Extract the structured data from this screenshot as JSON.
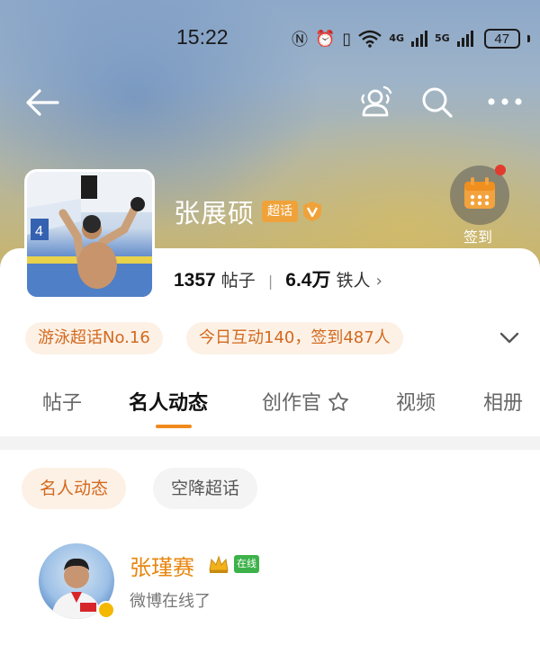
{
  "status_bar": {
    "time": "15:22",
    "signal_1": "4G",
    "signal_2": "5G",
    "battery": "47"
  },
  "nav": {
    "back_icon": "back-arrow-icon",
    "topic_icon": "community-icon",
    "search_icon": "search-icon",
    "more_icon": "more-icon"
  },
  "profile": {
    "name": "张展硕",
    "badge": "超话",
    "posts_count": "1357",
    "posts_label": "帖子",
    "fans_count": "6.4万",
    "fans_label": "铁人",
    "checkin_label": "签到"
  },
  "chips": {
    "rank": "游泳超话No.16",
    "today": "今日互动140，签到487人"
  },
  "tabs": [
    {
      "label": "帖子",
      "active": false
    },
    {
      "label": "名人动态",
      "active": true
    },
    {
      "label": "创作官",
      "active": false
    },
    {
      "label": "视频",
      "active": false
    },
    {
      "label": "相册",
      "active": false
    }
  ],
  "filters": {
    "celebrity": "名人动态",
    "airdrop": "空降超话"
  },
  "feed": {
    "user_name": "张瑾赛",
    "online_badge": "在线",
    "status_text": "微博在线了"
  },
  "colors": {
    "accent": "#f08a1c",
    "chip_text": "#d2691e",
    "chip_bg": "#fdf1e6",
    "online_green": "#3db24a"
  }
}
